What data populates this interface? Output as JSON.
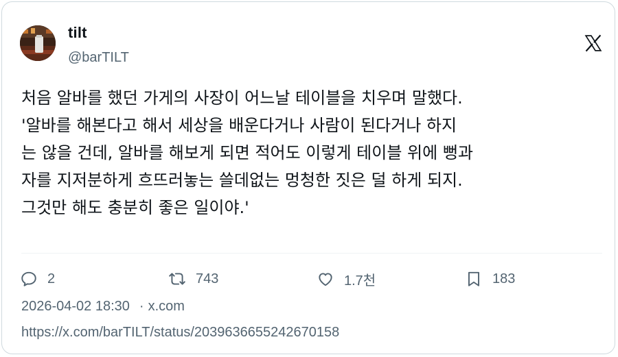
{
  "author": {
    "name": "tilt",
    "handle": "@barTILT"
  },
  "tweet": {
    "lines": [
      "처음 알바를 했던 가게의 사장이 어느날 테이블을 치우며 말했다.",
      "'알바를 해본다고 해서 세상을 배운다거나 사람이 된다거나 하지",
      "는 않을 건데, 알바를 해보게 되면 적어도 이렇게 테이블 위에 뻥과",
      "자를 지저분하게 흐뜨러놓는 쓸데없는 멍청한 짓은 덜 하게 되지.",
      "그것만 해도 충분히 좋은 일이야.'"
    ]
  },
  "actions": {
    "replies": "2",
    "retweets": "743",
    "likes": "1.7천",
    "bookmarks": "183"
  },
  "meta": {
    "timestamp": "2026-04-02 18:30",
    "separator": "·",
    "source": "x.com"
  },
  "url": "https://x.com/barTILT/status/2039636655242670158",
  "icons": {
    "brand": "x-logo-icon",
    "reply": "reply-icon",
    "retweet": "retweet-icon",
    "like": "heart-icon",
    "bookmark": "bookmark-icon"
  },
  "colors": {
    "text": "#0f1419",
    "secondary": "#536471",
    "border": "#cfd9de"
  }
}
